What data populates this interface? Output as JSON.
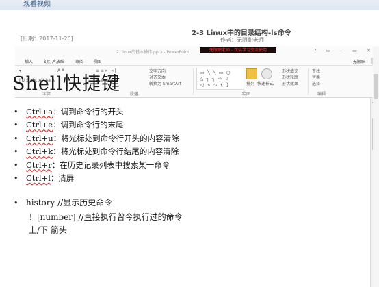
{
  "window": {
    "title": "观看视频"
  },
  "header": {
    "date": "[日期：2017-11-20]",
    "video_title": "2-3 Linux中的目录结构-ls命令",
    "author": "作者：无限职老师"
  },
  "ppt": {
    "window_title": "2. linux的基本操作.pptx - PowerPoint",
    "banner": "无限职老师 - 仅供学习交流使用",
    "tabs": [
      "插入",
      "幻灯片放映",
      "审阅",
      "视图"
    ],
    "user": "无限职 -",
    "ribbon": {
      "font_size_hint": "A A",
      "text_direction": "文字方向",
      "align_text": "对齐文本",
      "smartart": "转换为 SmartArt",
      "arrange": "排列",
      "quick_styles": "快速样式",
      "shape_fill": "形状填充",
      "shape_outline": "形状轮廓",
      "shape_effects": "形状效果",
      "find": "查找",
      "replace": "替换",
      "select": "选择",
      "group_font": "字体",
      "group_paragraph": "段落",
      "group_drawing": "绘图",
      "group_editing": "编辑"
    }
  },
  "slide": {
    "title": "Shell快捷键",
    "bullets": [
      {
        "key": "Ctrl+a",
        "text": "：调到命令行的开头"
      },
      {
        "key": "Ctrl+e",
        "text": "：调到命令行的末尾"
      },
      {
        "key": "Ctrl+u",
        "text": "：将光标处到命令行开头的内容清除"
      },
      {
        "key": "Ctrl+k",
        "text": "：将光标处到命令行结尾的内容清除"
      },
      {
        "key": "Ctrl+r",
        "text": "：在历史记录列表中搜索某一命令"
      },
      {
        "key": "Ctrl+l",
        "text": "：清屏"
      }
    ],
    "history_line": "history  //显示历史命令",
    "sub_line_1": "！[number]   //直接执行曾今执行过的命令",
    "sub_line_2": "上/下 箭头"
  }
}
